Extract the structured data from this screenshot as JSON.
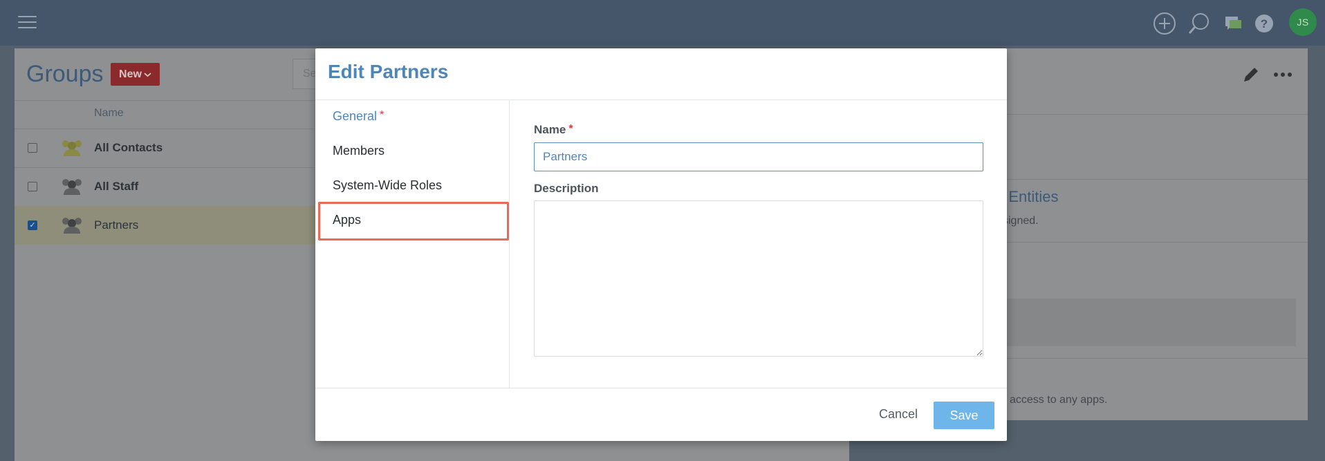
{
  "header": {
    "menu_icon": "hamburger-icon",
    "icons": [
      "plus-circle-icon",
      "search-icon",
      "chat-icon",
      "help-icon"
    ],
    "avatar_initials": "JS"
  },
  "groups": {
    "title": "Groups",
    "new_button": "New",
    "search_placeholder": "Se",
    "column_name": "Name",
    "rows": [
      {
        "label": "All Contacts",
        "checked": false
      },
      {
        "label": "All Staff",
        "checked": false
      },
      {
        "label": "Partners",
        "checked": true
      }
    ]
  },
  "right_panel": {
    "section_title_fragment": "n Entities",
    "section_text_fragment": "ssigned.",
    "apps_text_fragment": "access to any apps."
  },
  "modal": {
    "title": "Edit Partners",
    "nav": [
      {
        "label": "General",
        "required": true,
        "active": true
      },
      {
        "label": "Members",
        "required": false,
        "active": false
      },
      {
        "label": "System-Wide Roles",
        "required": false,
        "active": false
      },
      {
        "label": "Apps",
        "required": false,
        "active": false
      }
    ],
    "required_mark": "*",
    "name_label": "Name",
    "name_value": "Partners",
    "description_label": "Description",
    "description_value": "",
    "cancel_label": "Cancel",
    "save_label": "Save"
  },
  "colors": {
    "accent": "#4f86b8",
    "required": "#e0393e",
    "highlight": "#e96a57",
    "save": "#6eb6ea",
    "new_button": "#8a2a2c"
  }
}
